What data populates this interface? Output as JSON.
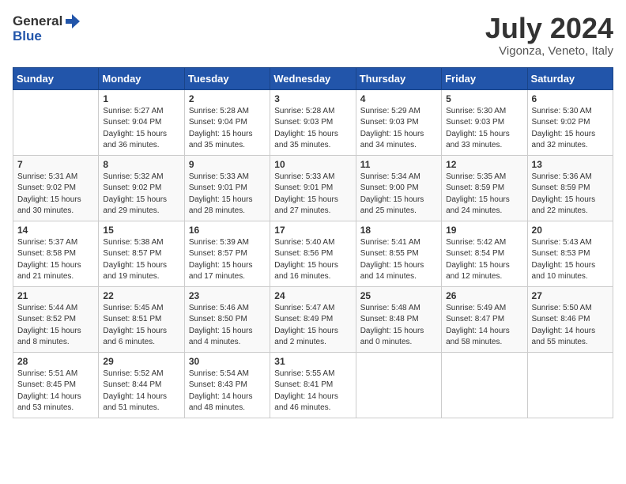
{
  "header": {
    "logo_general": "General",
    "logo_blue": "Blue",
    "month": "July 2024",
    "location": "Vigonza, Veneto, Italy"
  },
  "weekdays": [
    "Sunday",
    "Monday",
    "Tuesday",
    "Wednesday",
    "Thursday",
    "Friday",
    "Saturday"
  ],
  "weeks": [
    [
      {
        "day": "",
        "info": ""
      },
      {
        "day": "1",
        "info": "Sunrise: 5:27 AM\nSunset: 9:04 PM\nDaylight: 15 hours\nand 36 minutes."
      },
      {
        "day": "2",
        "info": "Sunrise: 5:28 AM\nSunset: 9:04 PM\nDaylight: 15 hours\nand 35 minutes."
      },
      {
        "day": "3",
        "info": "Sunrise: 5:28 AM\nSunset: 9:03 PM\nDaylight: 15 hours\nand 35 minutes."
      },
      {
        "day": "4",
        "info": "Sunrise: 5:29 AM\nSunset: 9:03 PM\nDaylight: 15 hours\nand 34 minutes."
      },
      {
        "day": "5",
        "info": "Sunrise: 5:30 AM\nSunset: 9:03 PM\nDaylight: 15 hours\nand 33 minutes."
      },
      {
        "day": "6",
        "info": "Sunrise: 5:30 AM\nSunset: 9:02 PM\nDaylight: 15 hours\nand 32 minutes."
      }
    ],
    [
      {
        "day": "7",
        "info": "Sunrise: 5:31 AM\nSunset: 9:02 PM\nDaylight: 15 hours\nand 30 minutes."
      },
      {
        "day": "8",
        "info": "Sunrise: 5:32 AM\nSunset: 9:02 PM\nDaylight: 15 hours\nand 29 minutes."
      },
      {
        "day": "9",
        "info": "Sunrise: 5:33 AM\nSunset: 9:01 PM\nDaylight: 15 hours\nand 28 minutes."
      },
      {
        "day": "10",
        "info": "Sunrise: 5:33 AM\nSunset: 9:01 PM\nDaylight: 15 hours\nand 27 minutes."
      },
      {
        "day": "11",
        "info": "Sunrise: 5:34 AM\nSunset: 9:00 PM\nDaylight: 15 hours\nand 25 minutes."
      },
      {
        "day": "12",
        "info": "Sunrise: 5:35 AM\nSunset: 8:59 PM\nDaylight: 15 hours\nand 24 minutes."
      },
      {
        "day": "13",
        "info": "Sunrise: 5:36 AM\nSunset: 8:59 PM\nDaylight: 15 hours\nand 22 minutes."
      }
    ],
    [
      {
        "day": "14",
        "info": "Sunrise: 5:37 AM\nSunset: 8:58 PM\nDaylight: 15 hours\nand 21 minutes."
      },
      {
        "day": "15",
        "info": "Sunrise: 5:38 AM\nSunset: 8:57 PM\nDaylight: 15 hours\nand 19 minutes."
      },
      {
        "day": "16",
        "info": "Sunrise: 5:39 AM\nSunset: 8:57 PM\nDaylight: 15 hours\nand 17 minutes."
      },
      {
        "day": "17",
        "info": "Sunrise: 5:40 AM\nSunset: 8:56 PM\nDaylight: 15 hours\nand 16 minutes."
      },
      {
        "day": "18",
        "info": "Sunrise: 5:41 AM\nSunset: 8:55 PM\nDaylight: 15 hours\nand 14 minutes."
      },
      {
        "day": "19",
        "info": "Sunrise: 5:42 AM\nSunset: 8:54 PM\nDaylight: 15 hours\nand 12 minutes."
      },
      {
        "day": "20",
        "info": "Sunrise: 5:43 AM\nSunset: 8:53 PM\nDaylight: 15 hours\nand 10 minutes."
      }
    ],
    [
      {
        "day": "21",
        "info": "Sunrise: 5:44 AM\nSunset: 8:52 PM\nDaylight: 15 hours\nand 8 minutes."
      },
      {
        "day": "22",
        "info": "Sunrise: 5:45 AM\nSunset: 8:51 PM\nDaylight: 15 hours\nand 6 minutes."
      },
      {
        "day": "23",
        "info": "Sunrise: 5:46 AM\nSunset: 8:50 PM\nDaylight: 15 hours\nand 4 minutes."
      },
      {
        "day": "24",
        "info": "Sunrise: 5:47 AM\nSunset: 8:49 PM\nDaylight: 15 hours\nand 2 minutes."
      },
      {
        "day": "25",
        "info": "Sunrise: 5:48 AM\nSunset: 8:48 PM\nDaylight: 15 hours\nand 0 minutes."
      },
      {
        "day": "26",
        "info": "Sunrise: 5:49 AM\nSunset: 8:47 PM\nDaylight: 14 hours\nand 58 minutes."
      },
      {
        "day": "27",
        "info": "Sunrise: 5:50 AM\nSunset: 8:46 PM\nDaylight: 14 hours\nand 55 minutes."
      }
    ],
    [
      {
        "day": "28",
        "info": "Sunrise: 5:51 AM\nSunset: 8:45 PM\nDaylight: 14 hours\nand 53 minutes."
      },
      {
        "day": "29",
        "info": "Sunrise: 5:52 AM\nSunset: 8:44 PM\nDaylight: 14 hours\nand 51 minutes."
      },
      {
        "day": "30",
        "info": "Sunrise: 5:54 AM\nSunset: 8:43 PM\nDaylight: 14 hours\nand 48 minutes."
      },
      {
        "day": "31",
        "info": "Sunrise: 5:55 AM\nSunset: 8:41 PM\nDaylight: 14 hours\nand 46 minutes."
      },
      {
        "day": "",
        "info": ""
      },
      {
        "day": "",
        "info": ""
      },
      {
        "day": "",
        "info": ""
      }
    ]
  ]
}
